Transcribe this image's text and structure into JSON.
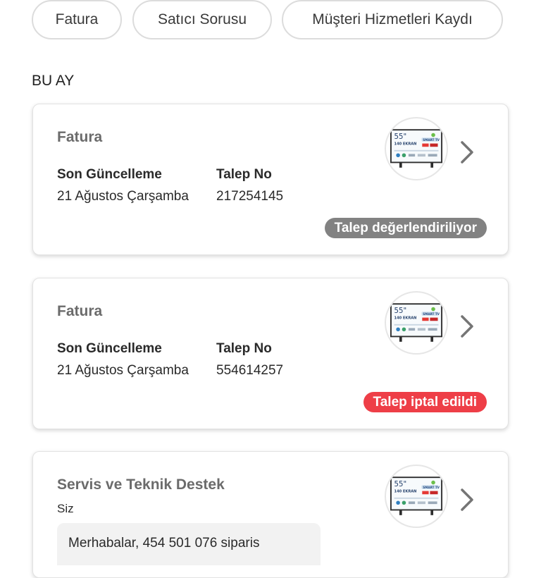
{
  "filters": [
    {
      "label": "Fatura"
    },
    {
      "label": "Satıcı Sorusu"
    },
    {
      "label": "Müşteri Hizmetleri Kaydı"
    }
  ],
  "section_title": "BU AY",
  "fields": {
    "updated_label": "Son Güncelleme",
    "request_no_label": "Talep No"
  },
  "requests": [
    {
      "category": "Fatura",
      "updated": "21 Ağustos Çarşamba",
      "request_no": "217254145",
      "status": "Talep değerlendiriliyor",
      "status_color": "#828282",
      "product_icon": "tv-product-thumbnail"
    },
    {
      "category": "Fatura",
      "updated": "21 Ağustos Çarşamba",
      "request_no": "554614257",
      "status": "Talep iptal edildi",
      "status_color": "#ee3e47",
      "product_icon": "tv-product-thumbnail"
    },
    {
      "category": "Servis ve Teknik Destek",
      "author": "Siz",
      "message": "Merhabalar, 454 501 076 siparis",
      "product_icon": "tv-product-thumbnail"
    }
  ],
  "icons": {
    "chevron": "chevron-right-icon"
  },
  "colors": {
    "chip_border": "#dcdcdc",
    "chevron": "#757575"
  }
}
